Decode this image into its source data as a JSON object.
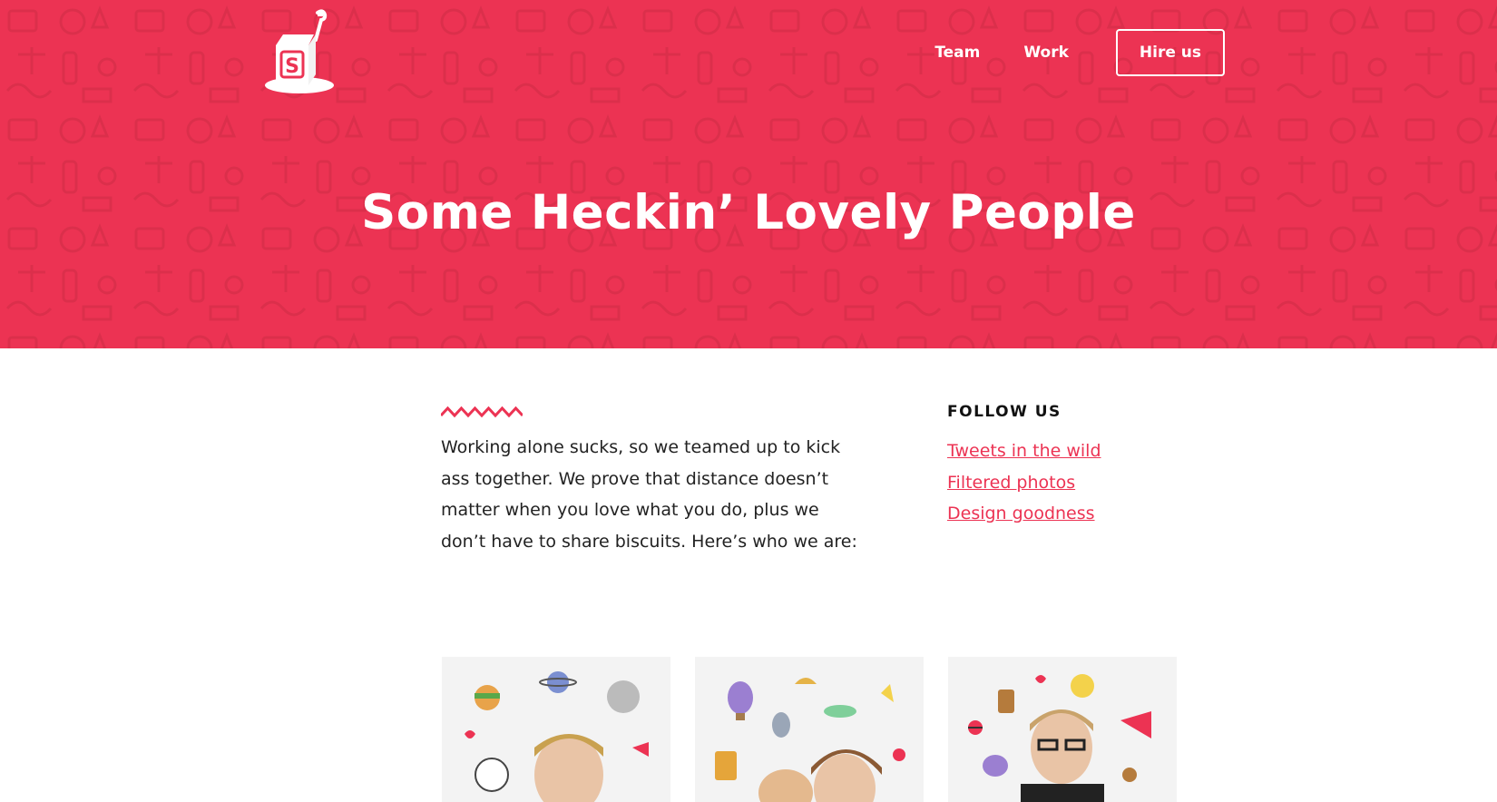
{
  "header": {
    "logo_alt": "S juice box logo",
    "nav": [
      {
        "label": "Team"
      },
      {
        "label": "Work"
      }
    ],
    "hire_label": "Hire us",
    "title": "Some Heckin’ Lovely People"
  },
  "intro": {
    "text": "Working alone sucks, so we teamed up to kick ass together. We prove that distance doesn’t matter when you love what you do, plus we don’t have to share biscuits. Here’s who we are:"
  },
  "follow": {
    "heading": "FOLLOW US",
    "links": [
      {
        "label": "Tweets in the wild"
      },
      {
        "label": "Filtered photos"
      },
      {
        "label": "Design goodness"
      }
    ]
  },
  "colors": {
    "brand": "#ec3353",
    "card_bg": "#f3f3f3"
  },
  "team": [
    {
      "icon": "team-member-1-photo"
    },
    {
      "icon": "team-member-2-photo"
    },
    {
      "icon": "team-member-3-photo"
    }
  ]
}
